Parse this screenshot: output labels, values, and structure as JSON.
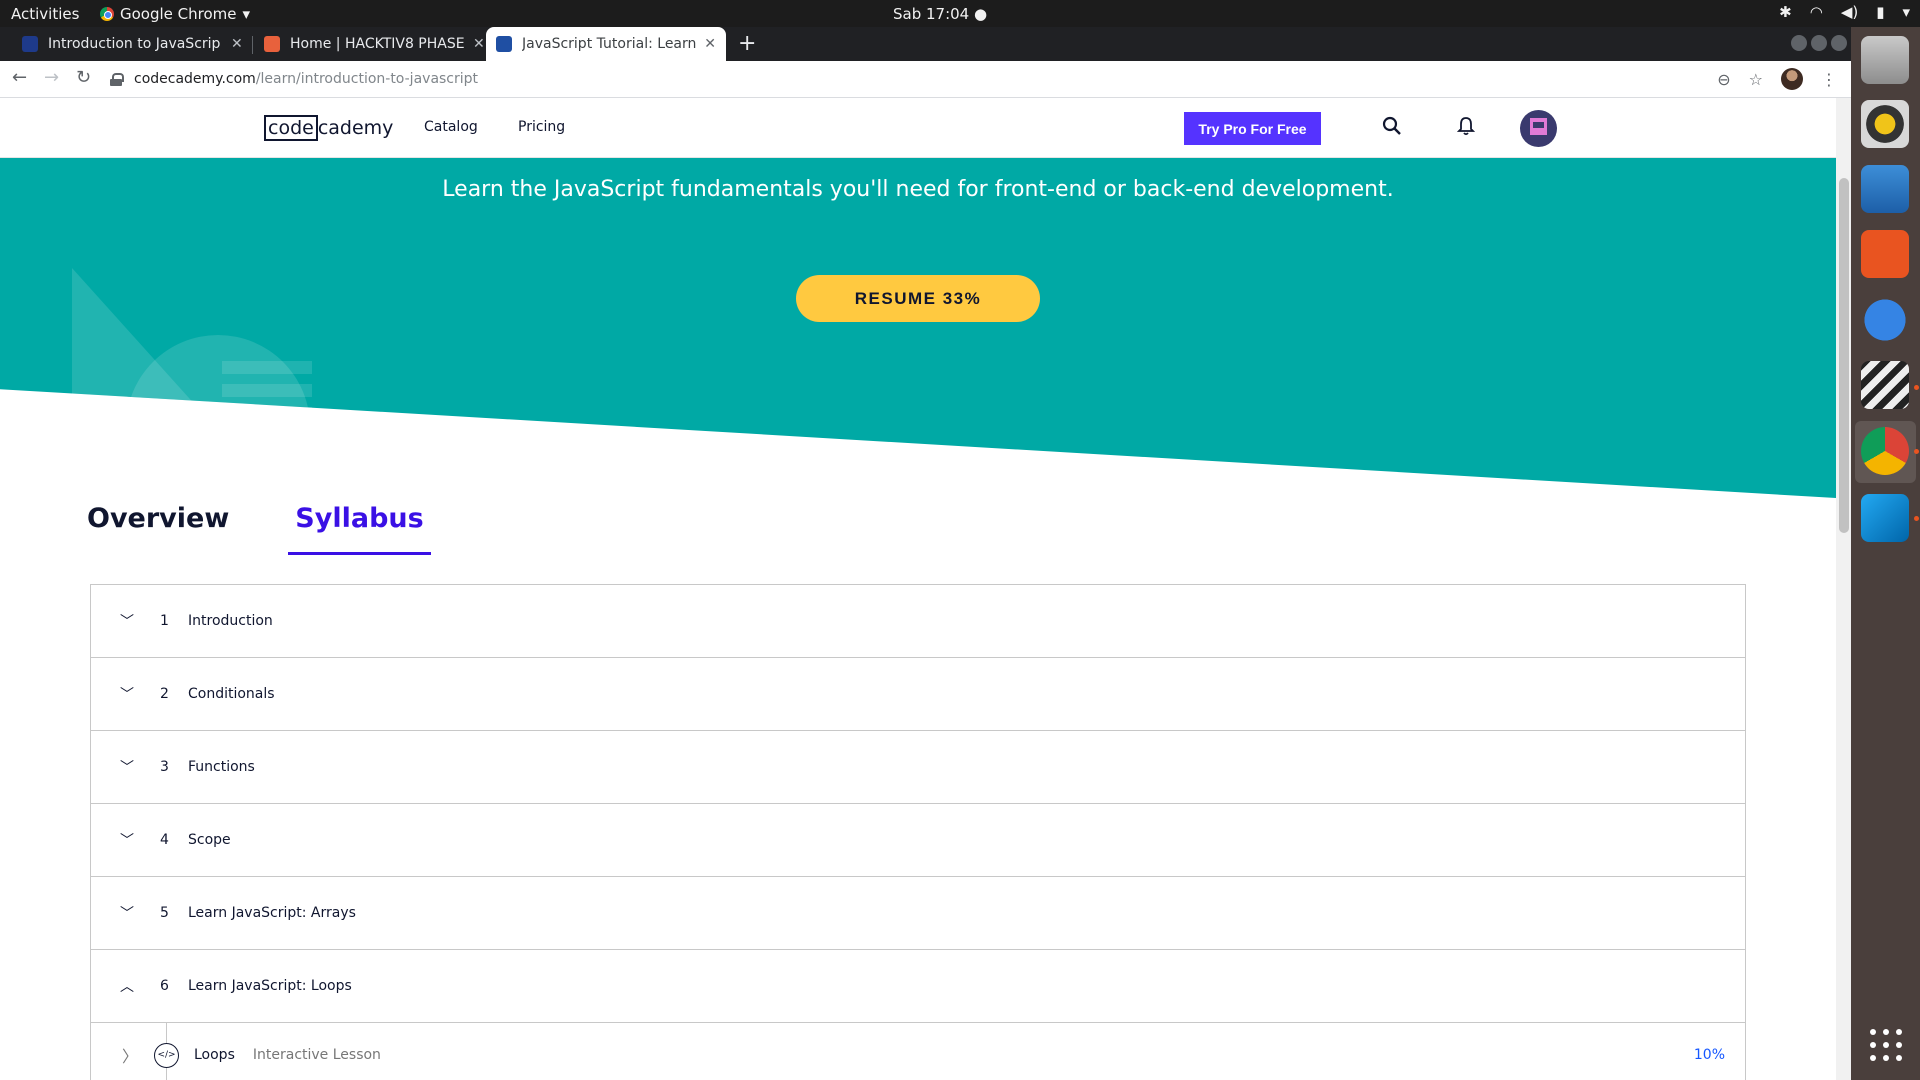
{
  "os": {
    "activities": "Activities",
    "app_name": "Google Chrome",
    "clock": "Sab 17:04"
  },
  "browser": {
    "tabs": [
      {
        "title": "Introduction to JavaScrip",
        "favicon_color": "#1e3a8a"
      },
      {
        "title": "Home | HACKTIV8 PHASE",
        "favicon_color": "#e8613c"
      },
      {
        "title": "JavaScript Tutorial: Learn",
        "favicon_color": "#1f4fa3",
        "active": true
      }
    ],
    "url_domain": "codecademy.com",
    "url_path": "/learn/introduction-to-javascript"
  },
  "header": {
    "logo_code": "code",
    "logo_rest": "cademy",
    "nav": [
      "Catalog",
      "Pricing"
    ],
    "cta": "Try Pro For Free"
  },
  "hero": {
    "subtitle": "Learn the JavaScript fundamentals you'll need for front-end or back-end development.",
    "resume_label": "RESUME 33%",
    "background": "#00a9a5"
  },
  "tabs": [
    {
      "label": "Overview"
    },
    {
      "label": "Syllabus",
      "active": true
    }
  ],
  "syllabus": {
    "modules": [
      {
        "num": "1",
        "name": "Introduction",
        "expanded": false
      },
      {
        "num": "2",
        "name": "Conditionals",
        "expanded": false
      },
      {
        "num": "3",
        "name": "Functions",
        "expanded": false
      },
      {
        "num": "4",
        "name": "Scope",
        "expanded": false
      },
      {
        "num": "5",
        "name": "Learn JavaScript: Arrays",
        "expanded": false
      },
      {
        "num": "6",
        "name": "Learn JavaScript: Loops",
        "expanded": true
      }
    ],
    "lesson": {
      "name": "Loops",
      "type": "Interactive Lesson",
      "progress": "10%",
      "icon": "</>"
    }
  },
  "colors": {
    "accent": "#3a10e5",
    "cta": "#5533ff",
    "resume": "#ffc940",
    "progress_link": "#1557ff"
  }
}
